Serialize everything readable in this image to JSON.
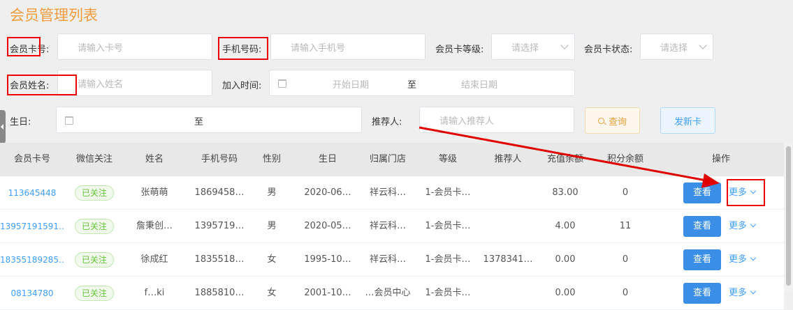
{
  "page": {
    "title": "会员管理列表"
  },
  "filters": {
    "card_no": {
      "label": "会员卡号:",
      "placeholder": "请输入卡号"
    },
    "phone": {
      "label": "手机号码:",
      "placeholder": "请输入手机号"
    },
    "level": {
      "label": "会员卡等级:",
      "placeholder": "请选择"
    },
    "status": {
      "label": "会员卡状态:",
      "placeholder": "请选择"
    },
    "name": {
      "label": "会员姓名:",
      "placeholder": "请输入姓名"
    },
    "join_time": {
      "label": "加入时间:",
      "start_placeholder": "开始日期",
      "separator": "至",
      "end_placeholder": "结束日期"
    },
    "birthday": {
      "label": "生日:",
      "separator": "至"
    },
    "referrer": {
      "label": "推荐人:",
      "placeholder": "请输入推荐人"
    }
  },
  "actions": {
    "query_label": "查询",
    "new_card_label": "发新卡"
  },
  "table": {
    "columns": [
      "会员卡号",
      "微信关注",
      "姓名",
      "手机号码",
      "性别",
      "生日",
      "归属门店",
      "等级",
      "推荐人",
      "充值余额",
      "积分余额",
      "操作"
    ],
    "rows": [
      {
        "card": "113645448",
        "wechat": "已关注",
        "name": "张萌萌",
        "phone": "1869458…",
        "gender": "男",
        "birthday": "2020-06…",
        "store": "祥云科…",
        "level": "1-会员卡…",
        "referrer": "",
        "balance": "83.00",
        "points": "0",
        "view": "查看",
        "more": "更多"
      },
      {
        "card": "13957191591…",
        "wechat": "已关注",
        "name": "詹秉创…",
        "phone": "1395719…",
        "gender": "男",
        "birthday": "2020-05…",
        "store": "祥云科…",
        "level": "1-会员卡…",
        "referrer": "",
        "balance": "4.00",
        "points": "11",
        "view": "查看",
        "more": "更多"
      },
      {
        "card": "18355189285…",
        "wechat": "已关注",
        "name": "徐成红",
        "phone": "1835518…",
        "gender": "女",
        "birthday": "1995-10…",
        "store": "祥云科…",
        "level": "1-会员卡…",
        "referrer": "1378341…",
        "balance": "0.00",
        "points": "0",
        "view": "查看",
        "more": "更多"
      },
      {
        "card": "08134780",
        "wechat": "已关注",
        "name": "f…ki",
        "phone": "1885810…",
        "gender": "女",
        "birthday": "2001-10…",
        "store": "…会员中心",
        "level": "1-会员卡…",
        "referrer": "",
        "balance": "0.00",
        "points": "0",
        "view": "查看",
        "more": "更多"
      }
    ]
  },
  "colors": {
    "title": "#f39c3f",
    "annotation": "#e00000",
    "primary": "#3a8ee6",
    "link": "#409eff",
    "tag_green": "#67c23a"
  }
}
